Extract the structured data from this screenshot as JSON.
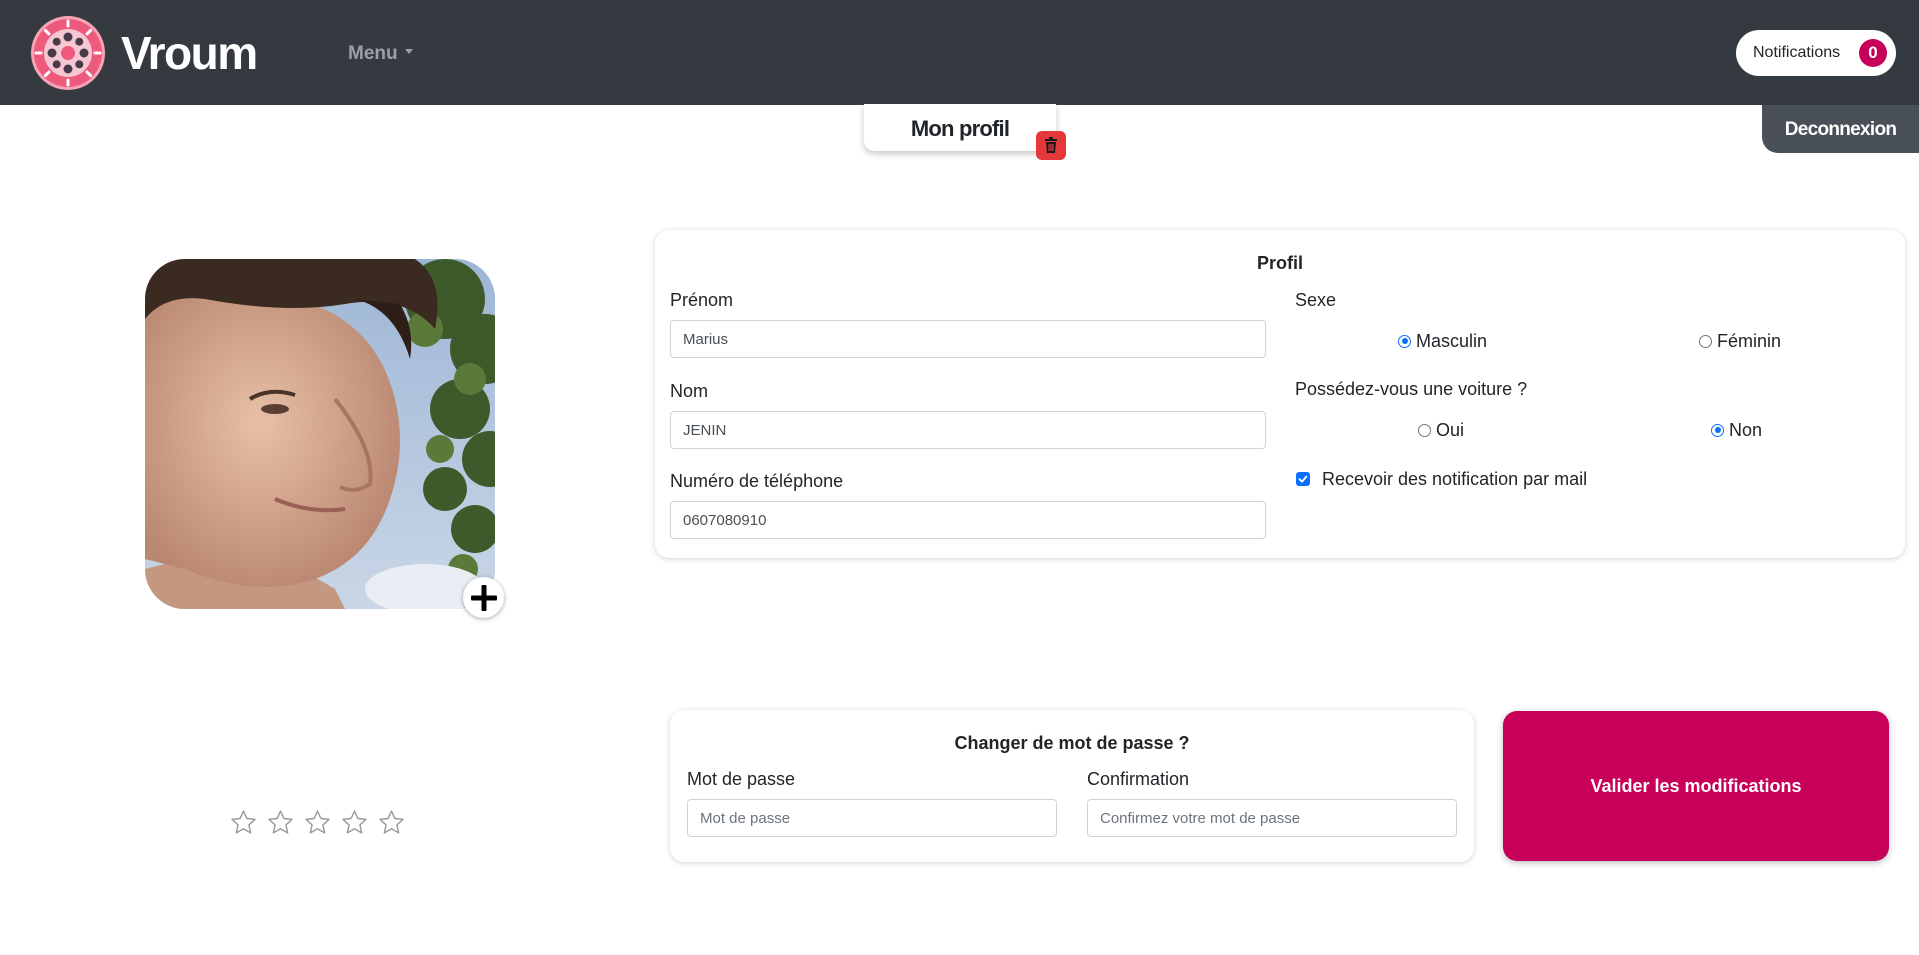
{
  "navbar": {
    "brand": "Vroum",
    "menu_label": "Menu",
    "notifications_label": "Notifications",
    "notifications_count": "0"
  },
  "profile_tab": {
    "title": "Mon profil"
  },
  "logout_label": "Deconnexion",
  "rating": {
    "stars_filled": 0,
    "stars_total": 5
  },
  "profile_form": {
    "title": "Profil",
    "firstname_label": "Prénom",
    "firstname_value": "Marius",
    "lastname_label": "Nom",
    "lastname_value": "JENIN",
    "phone_label": "Numéro de téléphone",
    "phone_value": "0607080910",
    "sex_label": "Sexe",
    "sex_options": [
      "Masculin",
      "Féminin"
    ],
    "sex_selected": "Masculin",
    "car_label": "Possédez-vous une voiture ?",
    "car_options": [
      "Oui",
      "Non"
    ],
    "car_selected": "Non",
    "notifications_checkbox_label": "Recevoir des notification par mail",
    "notifications_checked": true
  },
  "password_form": {
    "title": "Changer de mot de passe ?",
    "password_label": "Mot de passe",
    "password_placeholder": "Mot de passe",
    "confirm_label": "Confirmation",
    "confirm_placeholder": "Confirmez votre mot de passe"
  },
  "validate_label": "Valider les modifications",
  "colors": {
    "navbar": "#343a40",
    "accent": "#c7005a",
    "danger": "#e5383b",
    "radio": "#0d6efd"
  }
}
